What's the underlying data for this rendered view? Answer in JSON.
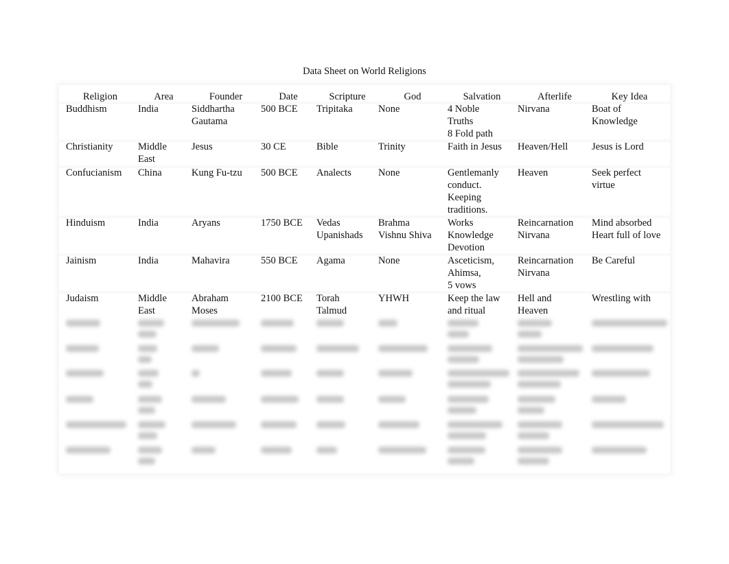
{
  "document": {
    "title": "Data Sheet on World Religions"
  },
  "table": {
    "headers": [
      "Religion",
      "Area",
      "Founder",
      "Date",
      "Scripture",
      "God",
      "Salvation",
      "Afterlife",
      "Key Idea"
    ],
    "rows": [
      [
        "Buddhism",
        "India",
        "Siddhartha\nGautama",
        "500 BCE",
        "Tripitaka",
        "None",
        "4 Noble\nTruths\n8 Fold path",
        "Nirvana",
        "Boat of\nKnowledge"
      ],
      [
        "Christianity",
        "Middle\nEast",
        "Jesus",
        "30 CE",
        "Bible",
        "Trinity",
        "Faith in Jesus",
        "Heaven/Hell",
        "Jesus is Lord"
      ],
      [
        "Confucianism",
        "China",
        "Kung Fu-tzu",
        "500 BCE",
        "Analects",
        "None",
        "Gentlemanly\nconduct.\nKeeping\ntraditions.",
        "Heaven",
        "Seek perfect\nvirtue"
      ],
      [
        "Hinduism",
        "India",
        "Aryans",
        "1750 BCE",
        "Vedas\nUpanishads",
        "Brahma\nVishnu Shiva",
        "Works\nKnowledge\nDevotion",
        "Reincarnation\nNirvana",
        "Mind absorbed\nHeart full of love"
      ],
      [
        "Jainism",
        "India",
        "Mahavira",
        "550 BCE",
        "Agama",
        "None",
        "Asceticism,\nAhimsa,\n 5 vows",
        "Reincarnation\nNirvana",
        "Be Careful"
      ],
      [
        "Judaism",
        "Middle\nEast",
        "Abraham\nMoses",
        "2100 BCE",
        "Torah\nTalmud",
        "YHWH",
        "Keep the law\nand ritual",
        "Hell and\nHeaven",
        "Wrestling with"
      ]
    ],
    "redacted_row_count": 6
  }
}
